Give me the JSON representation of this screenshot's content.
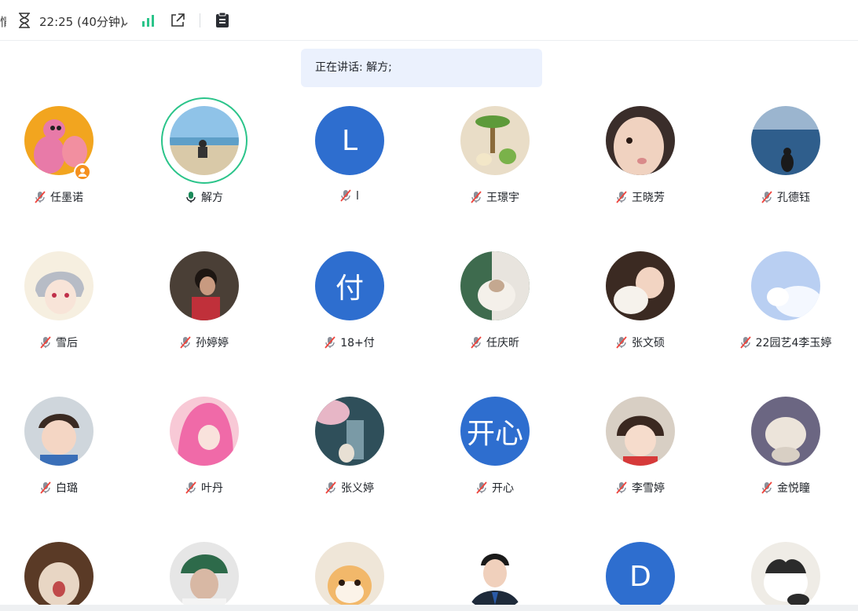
{
  "toolbar": {
    "clipped_label": "情",
    "time_label": "22:25 (40分钟)",
    "hourglass_icon": "hourglass-icon",
    "dropdown_icon": "chevron-down-icon",
    "signal_icon": "signal-bars-icon",
    "share_icon": "external-share-icon",
    "notes_icon": "notes-icon",
    "signal_color": "#2bc48a"
  },
  "speaking": {
    "text": "正在讲话: 解方;"
  },
  "colors": {
    "letter_avatar_bg": "#2e6ecf",
    "speaking_ring": "#2bc48a",
    "muted_mic": "#f0443c",
    "active_mic": "#1b8a5a",
    "host_badge": "#f5901e",
    "speaking_banner_bg": "#ebf1fd"
  },
  "participants": [
    {
      "name": "任墨诺",
      "mic": "muted",
      "avatar": "photo",
      "host": true
    },
    {
      "name": "解方",
      "mic": "active",
      "avatar": "photo",
      "speaking": true
    },
    {
      "name": "l",
      "mic": "muted",
      "avatar": "letter",
      "letter": "L"
    },
    {
      "name": "王璟宇",
      "mic": "muted",
      "avatar": "photo"
    },
    {
      "name": "王晓芳",
      "mic": "muted",
      "avatar": "photo"
    },
    {
      "name": "孔德钰",
      "mic": "muted",
      "avatar": "photo"
    },
    {
      "name": "雪后",
      "mic": "muted",
      "avatar": "photo"
    },
    {
      "name": "孙婷婷",
      "mic": "muted",
      "avatar": "photo"
    },
    {
      "name": "18+付",
      "mic": "muted",
      "avatar": "letter",
      "letter": "付"
    },
    {
      "name": "任庆昕",
      "mic": "muted",
      "avatar": "photo"
    },
    {
      "name": "张文硕",
      "mic": "muted",
      "avatar": "photo"
    },
    {
      "name": "22园艺4李玉婷",
      "mic": "muted",
      "avatar": "photo"
    },
    {
      "name": "白璐",
      "mic": "muted",
      "avatar": "photo"
    },
    {
      "name": "叶丹",
      "mic": "muted",
      "avatar": "photo"
    },
    {
      "name": "张义婷",
      "mic": "muted",
      "avatar": "photo"
    },
    {
      "name": "开心",
      "mic": "muted",
      "avatar": "letter",
      "letter": "开心"
    },
    {
      "name": "李雪婷",
      "mic": "muted",
      "avatar": "photo"
    },
    {
      "name": "金悦瞳",
      "mic": "muted",
      "avatar": "photo"
    },
    {
      "name": "",
      "avatar": "photo"
    },
    {
      "name": "",
      "avatar": "photo"
    },
    {
      "name": "",
      "avatar": "photo"
    },
    {
      "name": "",
      "avatar": "photo"
    },
    {
      "name": "",
      "avatar": "letter",
      "letter": "D"
    },
    {
      "name": "",
      "avatar": "photo"
    }
  ]
}
